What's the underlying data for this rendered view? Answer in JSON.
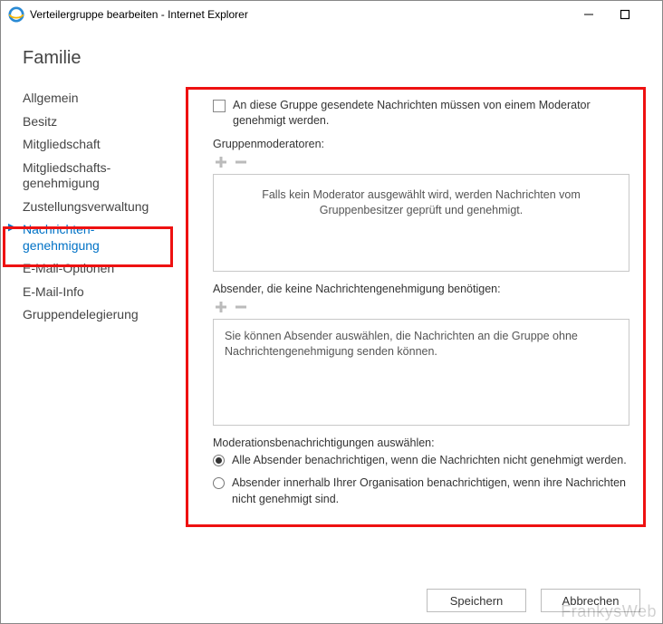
{
  "window": {
    "title": "Verteilergruppe bearbeiten - Internet Explorer"
  },
  "page_title": "Familie",
  "sidebar": {
    "items": [
      {
        "label": "Allgemein"
      },
      {
        "label": "Besitz"
      },
      {
        "label": "Mitgliedschaft"
      },
      {
        "label": "Mitgliedschafts-\ngenehmigung"
      },
      {
        "label": "Zustellungsverwaltung"
      },
      {
        "label": "Nachrichten-\ngenehmigung",
        "active": true
      },
      {
        "label": "E-Mail-Optionen"
      },
      {
        "label": "E-Mail-Info"
      },
      {
        "label": "Gruppendelegierung"
      }
    ]
  },
  "main": {
    "approval_checkbox_label": "An diese Gruppe gesendete Nachrichten müssen von einem Moderator genehmigt werden.",
    "moderators_label": "Gruppenmoderatoren:",
    "moderators_placeholder": "Falls kein Moderator ausgewählt wird, werden Nachrichten vom Gruppenbesitzer geprüft und genehmigt.",
    "bypass_label": "Absender, die keine Nachrichtengenehmigung benötigen:",
    "bypass_placeholder": "Sie können Absender auswählen, die Nachrichten an die Gruppe ohne Nachrichtengenehmigung senden können.",
    "notify_heading": "Moderationsbenachrichtigungen auswählen:",
    "notify_options": [
      {
        "label": "Alle Absender benachrichtigen, wenn die Nachrichten nicht genehmigt werden.",
        "checked": true
      },
      {
        "label": "Absender innerhalb Ihrer Organisation benachrichtigen, wenn ihre Nachrichten nicht genehmigt sind.",
        "checked": false
      }
    ]
  },
  "footer": {
    "save": "Speichern",
    "cancel": "Abbrechen"
  },
  "watermark": "FrankysWeb"
}
